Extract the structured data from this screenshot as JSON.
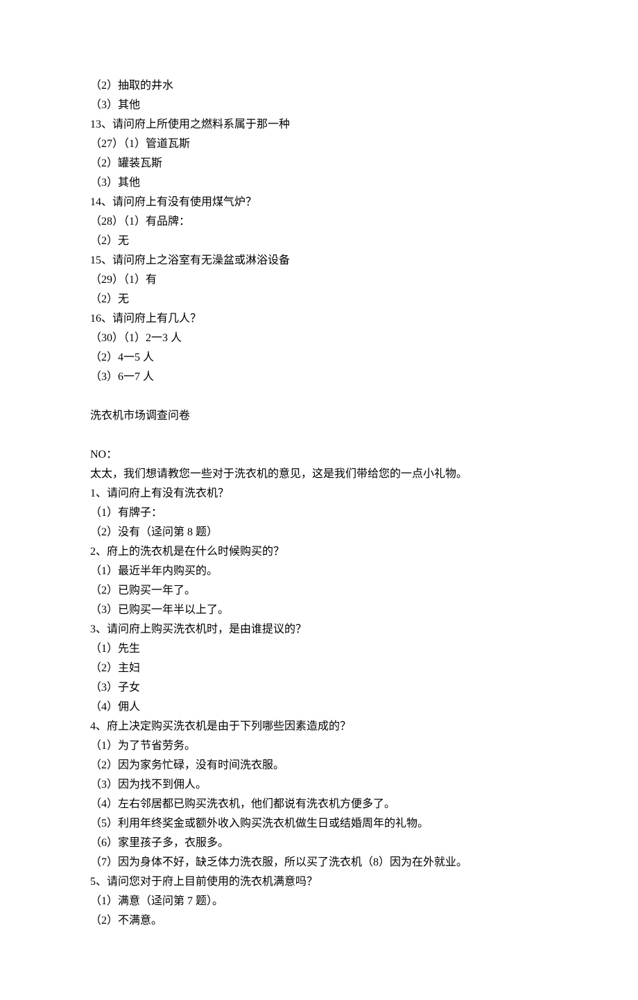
{
  "lines": [
    "（2）抽取的井水",
    "（3）其他",
    "13、请问府上所使用之燃料系属于那一种",
    "（27）（1）管道瓦斯",
    "（2）罐装瓦斯",
    "（3）其他",
    "14、请问府上有没有使用煤气炉？",
    "（28）（1）有品牌：",
    "（2）无",
    "15、请问府上之浴室有无澡盆或淋浴设备",
    "（29）（1）有",
    "（2）无",
    "16、请问府上有几人？",
    "（30）（1）2一3 人",
    "（2）4一5 人",
    "（3）6一7 人",
    "",
    "洗衣机市场调查问卷",
    "",
    "NO：",
    "太太，我们想请教您一些对于洗衣机的意见，这是我们带给您的一点小礼物。",
    "1、请问府上有没有洗衣机？",
    "（1）有牌子：",
    "（2）没有（迳问第 8 题）",
    "2、府上的洗衣机是在什么时候购买的？",
    "（1）最近半年内购买的。",
    "（2）已购买一年了。",
    "（3）已购买一年半以上了。",
    "3、请问府上购买洗衣机时，是由谁提议的？",
    "（1）先生",
    "（2）主妇",
    "（3）子女",
    "（4）佣人",
    "4、府上决定购买洗衣机是由于下列哪些因素造成的？",
    "（1）为了节省劳务。",
    "（2）因为家务忙碌，没有时间洗衣服。",
    "（3）因为找不到佣人。",
    "（4）左右邻居都已购买洗衣机，他们都说有洗衣机方便多了。",
    "（5）利用年终奖金或额外收入购买洗衣机做生日或结婚周年的礼物。",
    "（6）家里孩子多，衣服多。",
    "（7）因为身体不好，缺乏体力洗衣服，所以买了洗衣机（8）因为在外就业。",
    "5、请问您对于府上目前使用的洗衣机满意吗？",
    "（1）满意（迳问第 7 题）。",
    "（2）不满意。"
  ]
}
